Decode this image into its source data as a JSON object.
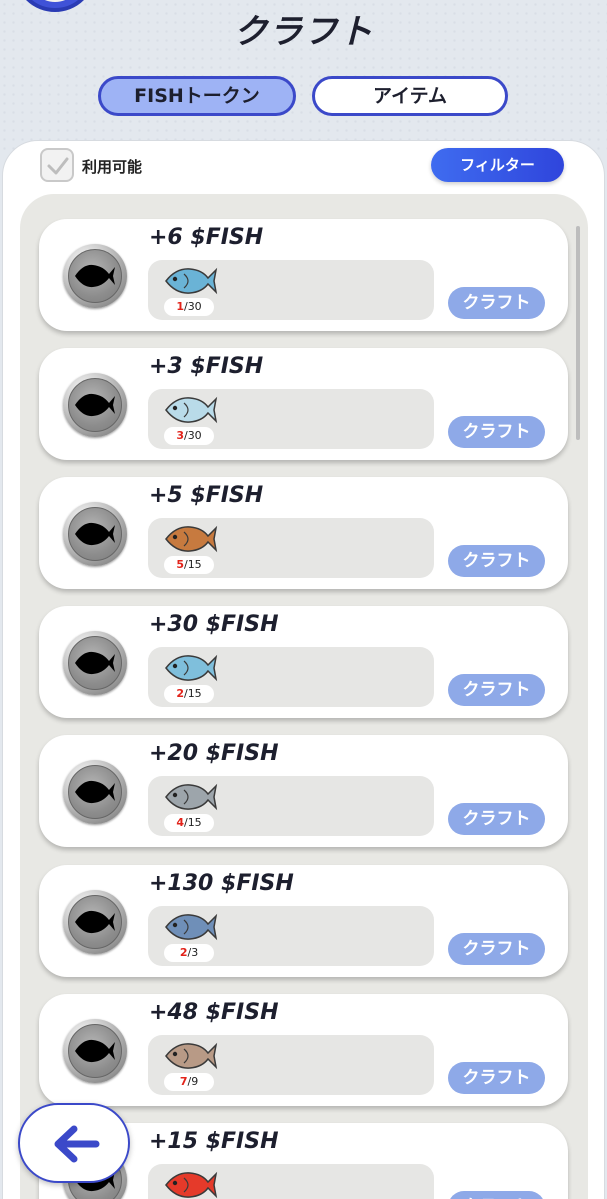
{
  "header": {
    "title": "クラフト"
  },
  "tabs": [
    {
      "label": "FISHトークン",
      "active": true
    },
    {
      "label": "アイテム",
      "active": false
    }
  ],
  "filters": {
    "available_label": "利用可能",
    "available_checked": true,
    "filter_button": "フィルター"
  },
  "craft_label": "クラフト",
  "recipes": [
    {
      "reward": "+6 $FISH",
      "fish_icon": "mackerel-icon",
      "fish_color": "#6ab3d6",
      "have": "1",
      "need": "30"
    },
    {
      "reward": "+3 $FISH",
      "fish_icon": "horse-mackerel-icon",
      "fish_color": "#b9dbe9",
      "have": "3",
      "need": "30"
    },
    {
      "reward": "+5 $FISH",
      "fish_icon": "flounder-icon",
      "fish_color": "#c77a3f",
      "have": "5",
      "need": "15"
    },
    {
      "reward": "+30 $FISH",
      "fish_icon": "yellowtail-icon",
      "fish_color": "#7fbfdc",
      "have": "2",
      "need": "15"
    },
    {
      "reward": "+20 $FISH",
      "fish_icon": "mullet-icon",
      "fish_color": "#9da5ab",
      "have": "4",
      "need": "15"
    },
    {
      "reward": "+130 $FISH",
      "fish_icon": "tuna-icon",
      "fish_color": "#6f8fb8",
      "have": "2",
      "need": "3"
    },
    {
      "reward": "+48 $FISH",
      "fish_icon": "salmon-icon",
      "fish_color": "#b89a86",
      "have": "7",
      "need": "9"
    },
    {
      "reward": "+15 $FISH",
      "fish_icon": "red-snapper-icon",
      "fish_color": "#e53a2a",
      "have": "",
      "need": ""
    }
  ],
  "colors": {
    "accent": "#3b49c9",
    "craft_button": "#8ea9e8",
    "count_have": "#e2231a"
  }
}
